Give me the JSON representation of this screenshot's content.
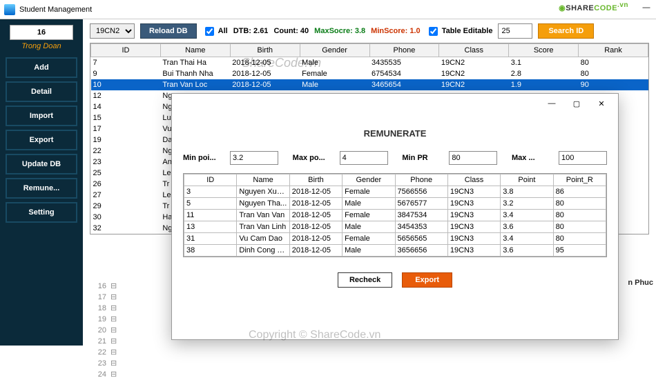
{
  "window": {
    "title": "Student Management"
  },
  "watermarks": {
    "top": "ShareCode.vn",
    "bottom": "Copyright © ShareCode.vn",
    "logo_main": "SHARE",
    "logo_sub": "CODE",
    "logo_vn": ".vn"
  },
  "sidebar": {
    "count": "16",
    "subtitle": "Trong Doan",
    "buttons": [
      "Add",
      "Detail",
      "Import",
      "Export",
      "Update DB",
      "Remune...",
      "Setting"
    ]
  },
  "toolbar": {
    "class_select": "19CN2",
    "reload": "Reload DB",
    "all": "All",
    "dtb": "DTB: 2.61",
    "count": "Count: 40",
    "max": "MaxSocre: 3.8",
    "min": "MinScore: 1.0",
    "editable": "Table Editable",
    "search_value": "25",
    "search_btn": "Search ID"
  },
  "main_table": {
    "headers": [
      "ID",
      "Name",
      "Birth",
      "Gender",
      "Phone",
      "Class",
      "Score",
      "Rank"
    ],
    "rows": [
      {
        "sel": false,
        "c": [
          "7",
          "Tran Thai Ha",
          "2018-12-05",
          "Male",
          "3435535",
          "19CN2",
          "3.1",
          "80"
        ]
      },
      {
        "sel": false,
        "c": [
          "9",
          "Bui Thanh Nha",
          "2018-12-05",
          "Female",
          "6754534",
          "19CN2",
          "2.8",
          "80"
        ]
      },
      {
        "sel": true,
        "c": [
          "10",
          "Tran Van Loc",
          "2018-12-05",
          "Male",
          "3465654",
          "19CN2",
          "1.9",
          "90"
        ]
      },
      {
        "sel": false,
        "c": [
          "12",
          "Ng",
          "",
          "",
          "",
          "",
          "",
          ""
        ]
      },
      {
        "sel": false,
        "c": [
          "14",
          "Ng",
          "",
          "",
          "",
          "",
          "",
          ""
        ]
      },
      {
        "sel": false,
        "c": [
          "15",
          "Lu",
          "",
          "",
          "",
          "",
          "",
          ""
        ]
      },
      {
        "sel": false,
        "c": [
          "17",
          "Vu",
          "",
          "",
          "",
          "",
          "",
          ""
        ]
      },
      {
        "sel": false,
        "c": [
          "19",
          "Da",
          "",
          "",
          "",
          "",
          "",
          ""
        ]
      },
      {
        "sel": false,
        "c": [
          "22",
          "Ng",
          "",
          "",
          "",
          "",
          "",
          ""
        ]
      },
      {
        "sel": false,
        "c": [
          "23",
          "An",
          "",
          "",
          "",
          "",
          "",
          ""
        ]
      },
      {
        "sel": false,
        "c": [
          "25",
          "Le",
          "",
          "",
          "",
          "",
          "",
          ""
        ]
      },
      {
        "sel": false,
        "c": [
          "26",
          "Tr",
          "",
          "",
          "",
          "",
          "",
          ""
        ]
      },
      {
        "sel": false,
        "c": [
          "27",
          "Le",
          "",
          "",
          "",
          "",
          "",
          ""
        ]
      },
      {
        "sel": false,
        "c": [
          "29",
          "Tr",
          "",
          "",
          "",
          "",
          "",
          ""
        ]
      },
      {
        "sel": false,
        "c": [
          "30",
          "Ha",
          "",
          "",
          "",
          "",
          "",
          ""
        ]
      },
      {
        "sel": false,
        "c": [
          "32",
          "Ng",
          "",
          "",
          "",
          "",
          "",
          ""
        ]
      }
    ]
  },
  "status_right": "n Phuc",
  "code_lines": [
    "16",
    "17",
    "18",
    "19",
    "20",
    "21",
    "22",
    "23",
    "24"
  ],
  "dialog": {
    "heading": "REMUNERATE",
    "labels": {
      "minp": "Min poi...",
      "maxp": "Max po...",
      "minpr": "Min PR",
      "maxpr": "Max ..."
    },
    "values": {
      "minp": "3.2",
      "maxp": "4",
      "minpr": "80",
      "maxpr": "100"
    },
    "headers": [
      "ID",
      "Name",
      "Birth",
      "Gender",
      "Phone",
      "Class",
      "Point",
      "Point_R"
    ],
    "rows": [
      [
        "3",
        "Nguyen Xua...",
        "2018-12-05",
        "Female",
        "7566556",
        "19CN3",
        "3.8",
        "86"
      ],
      [
        "5",
        "Nguyen Tha...",
        "2018-12-05",
        "Male",
        "5676577",
        "19CN3",
        "3.2",
        "80"
      ],
      [
        "11",
        "Tran Van Van",
        "2018-12-05",
        "Female",
        "3847534",
        "19CN3",
        "3.4",
        "80"
      ],
      [
        "13",
        "Tran Van Linh",
        "2018-12-05",
        "Male",
        "3454353",
        "19CN3",
        "3.6",
        "80"
      ],
      [
        "31",
        "Vu Cam Dao",
        "2018-12-05",
        "Female",
        "5656565",
        "19CN3",
        "3.4",
        "80"
      ],
      [
        "38",
        "Dinh Cong T...",
        "2018-12-05",
        "Male",
        "3656656",
        "19CN3",
        "3.6",
        "95"
      ]
    ],
    "recheck": "Recheck",
    "export": "Export"
  }
}
